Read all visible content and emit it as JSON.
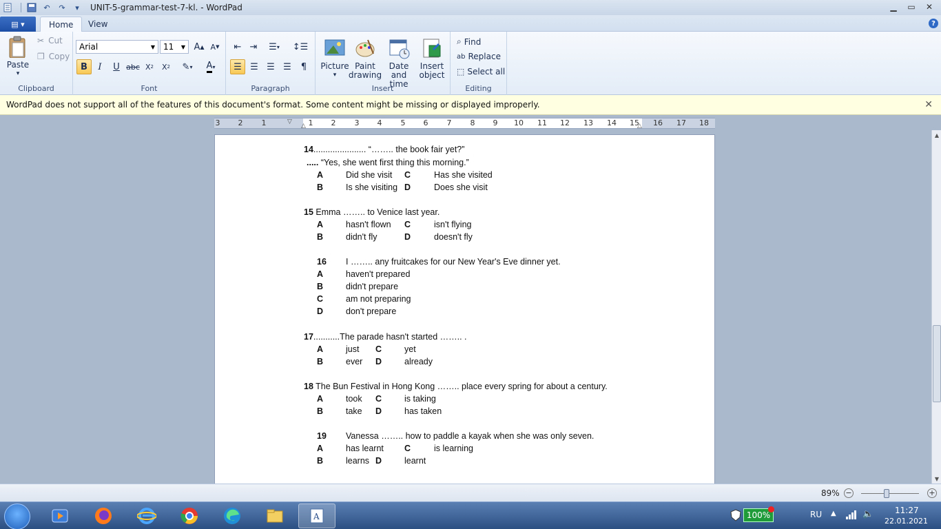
{
  "window": {
    "title": "UNIT-5-grammar-test-7-kl. - WordPad"
  },
  "tabs": [
    {
      "label": "Home"
    },
    {
      "label": "View"
    }
  ],
  "ribbon": {
    "clipboard": {
      "label": "Clipboard",
      "paste": "Paste",
      "cut": "Cut",
      "copy": "Copy"
    },
    "font": {
      "label": "Font",
      "family": "Arial",
      "size": "11"
    },
    "paragraph": {
      "label": "Paragraph"
    },
    "insert": {
      "label": "Insert",
      "picture": "Picture",
      "paint1": "Paint",
      "paint2": "drawing",
      "date1": "Date and",
      "date2": "time",
      "object1": "Insert",
      "object2": "object"
    },
    "editing": {
      "label": "Editing",
      "find": "Find",
      "replace": "Replace",
      "select_all": "Select all"
    }
  },
  "infobar": {
    "message": "WordPad does not support all of the features of this document's format. Some content might be missing or displayed improperly."
  },
  "ruler": {
    "labels": [
      "3",
      "2",
      "1",
      "1",
      "2",
      "3",
      "4",
      "5",
      "6",
      "7",
      "8",
      "9",
      "10",
      "11",
      "12",
      "13",
      "14",
      "15",
      "16",
      "17",
      "18"
    ]
  },
  "document": {
    "q14": {
      "num": "14",
      "stem": "...................... “…….. the book fair yet?”",
      "dots": ".....",
      "reply": " “Yes, she went first thing this morning.”",
      "a_key": "A",
      "a_text": "Did she visit",
      "c_key": "C",
      "c_text": "Has she visited",
      "b_key": "B",
      "b_text": "Is she visiting",
      "d_key": "D",
      "d_text": "Does she visit"
    },
    "q15": {
      "num": "15",
      "stem": " Emma …….. to Venice last year.",
      "a_key": "A",
      "a_text": "hasn't flown",
      "c_key": "C",
      "c_text": "isn't flying",
      "b_key": "B",
      "b_text": "didn't fly",
      "d_key": "D",
      "d_text": "doesn't fly"
    },
    "q16": {
      "num": "16",
      "stem": "I …….. any fruitcakes for our New Year's Eve dinner yet.",
      "a_key": "A",
      "a_text": "haven't prepared",
      "b_key": "B",
      "b_text": "didn't prepare",
      "c_key": "C",
      "c_text": "am not preparing",
      "d_key": "D",
      "d_text": "don't prepare"
    },
    "q17": {
      "num": "17",
      "stem": "...........The parade hasn't started …….. .",
      "a_key": "A",
      "a_text": "just",
      "c_key": "C",
      "c_text": "yet",
      "b_key": "B",
      "b_text": "ever",
      "d_key": "D",
      "d_text": "already"
    },
    "q18": {
      "num": "18",
      "stem": " The Bun Festival in Hong Kong …….. place every spring for about a century.",
      "a_key": "A",
      "a_text": "took",
      "c_key": "C",
      "c_text": "is taking",
      "b_key": "B",
      "b_text": "take",
      "d_key": "D",
      "d_text": "has taken"
    },
    "q19": {
      "num": "19",
      "stem": "Vanessa …….. how to paddle a kayak when she was only seven.",
      "a_key": "A",
      "a_text": "has learnt",
      "c_key": "C",
      "c_text": "is learning",
      "b_key": "B",
      "b_text": "learns",
      "d_key": "D",
      "d_text": "learnt"
    }
  },
  "statusbar": {
    "zoom": "89%",
    "zoom_out": "−",
    "zoom_in": "+"
  },
  "taskbar": {
    "battery": "100%",
    "language": "RU",
    "time": "11:27",
    "date": "22.01.2021"
  }
}
